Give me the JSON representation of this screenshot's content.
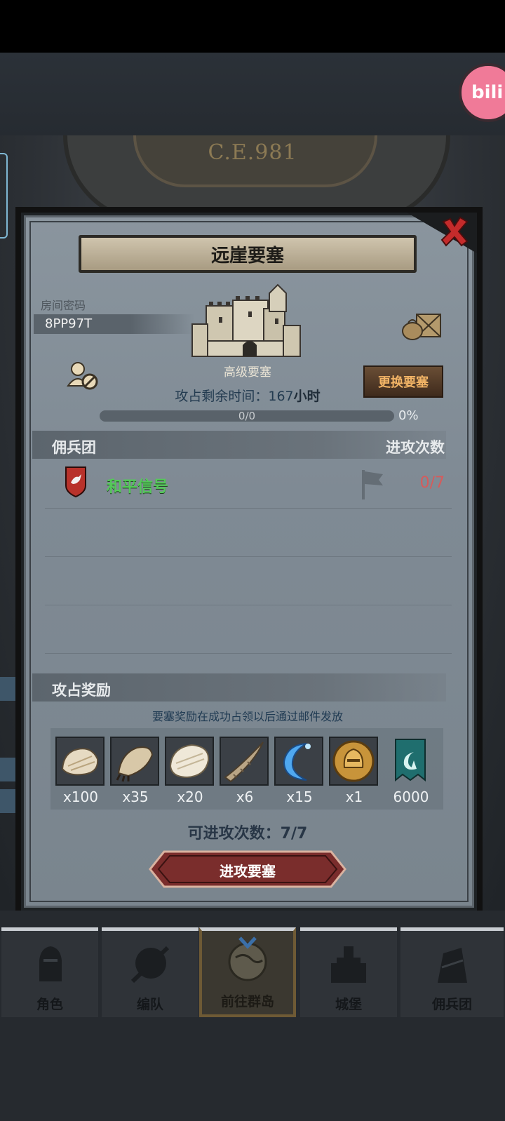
{
  "background": {
    "era": "C.E.981",
    "bili_badge": "bili"
  },
  "dialog": {
    "title": "远崖要塞",
    "room_label": "房间密码",
    "room_code": "8PP97T",
    "fortress_type": "高级要塞",
    "change_button": "更换要塞",
    "time_prefix": "攻占剩余时间：",
    "time_value": "167",
    "time_unit": "小时",
    "progress_text": "0/0",
    "progress_fraction": 0,
    "progress_percent": "0%",
    "mercenary_header": "佣兵团",
    "attack_count_header": "进攻次数",
    "guilds": [
      {
        "name": "和平信号",
        "attacks": "0/7"
      }
    ],
    "reward_header": "攻占奖励",
    "reward_note": "要塞奖励在成功占领以后通过邮件发放",
    "rewards": [
      {
        "icon": "hide-fur-icon",
        "qty": "x100"
      },
      {
        "icon": "claw-pelt-icon",
        "qty": "x35"
      },
      {
        "icon": "white-fur-icon",
        "qty": "x20"
      },
      {
        "icon": "horn-icon",
        "qty": "x6"
      },
      {
        "icon": "blue-crescent-icon",
        "qty": "x15"
      },
      {
        "icon": "gold-helmet-coin-icon",
        "qty": "x1"
      },
      {
        "icon": "guild-banner-icon",
        "qty": "6000"
      }
    ],
    "attacks_left_label": "可进攻次数：7/7",
    "attack_button": "进攻要塞"
  },
  "nav": [
    {
      "label": "角色",
      "icon": "knight-icon"
    },
    {
      "label": "编队",
      "icon": "formation-icon"
    },
    {
      "label": "前往群岛",
      "icon": "globe-icon",
      "active": true
    },
    {
      "label": "城堡",
      "icon": "castle-icon"
    },
    {
      "label": "佣兵团",
      "icon": "mercenary-icon"
    }
  ],
  "colors": {
    "accent_gold": "#c89a3e",
    "guild_green": "#55c95a",
    "attack_red": "#d65b5b",
    "button_red": "#7a2d2c"
  }
}
